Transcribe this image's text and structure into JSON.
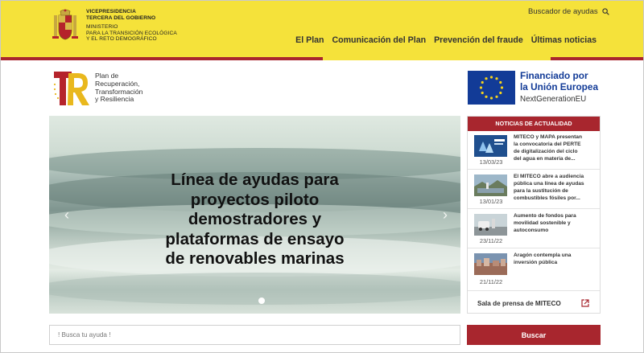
{
  "header": {
    "gov_lines": [
      "VICEPRESIDENCIA",
      "TERCERA DEL GOBIERNO"
    ],
    "ministry_lines": [
      "MINISTERIO",
      "PARA LA TRANSICIÓN ECOLÓGICA",
      "Y EL RETO DEMOGRÁFICO"
    ],
    "search_link": "Buscador de ayudas",
    "nav": [
      "El Plan",
      "Comunicación del Plan",
      "Prevención del fraude",
      "Últimas noticias"
    ]
  },
  "plan_logo": {
    "lines": [
      "Plan de",
      "Recuperación,",
      "Transformación",
      "y Resiliencia"
    ]
  },
  "eu_logo": {
    "line1": "Financiado por",
    "line2": "la Unión Europea",
    "line3": "NextGenerationEU"
  },
  "carousel": {
    "caption_lines": [
      "Línea de ayudas para",
      "proyectos piloto",
      "demostradores y",
      "plataformas de ensayo",
      "de renovables marinas"
    ],
    "prev": "‹",
    "next": "›"
  },
  "news": {
    "title": "NOTICIAS DE ACTUALIDAD",
    "items": [
      {
        "lines": [
          "MITECO y MAPA presentan",
          "la convocatoria del PERTE",
          "de digitalización del ciclo",
          "del agua en materia de..."
        ],
        "date": "13/03/23"
      },
      {
        "lines": [
          "El MITECO abre a audiencia",
          "pública una línea de ayudas",
          "para la sustitución de",
          "combustibles fósiles por..."
        ],
        "date": "13/01/23"
      },
      {
        "lines": [
          "Aumento de fondos para",
          "movilidad sostenible y",
          "autoconsumo"
        ],
        "date": "23/11/22"
      },
      {
        "lines": [
          "Aragón contempla una",
          "inversión pública"
        ],
        "date": "21/11/22"
      }
    ],
    "press_label": "Sala de prensa de MITECO"
  },
  "search": {
    "placeholder": "! Busca tu ayuda !",
    "button": "Buscar"
  },
  "colors": {
    "header_yellow": "#f5e23a",
    "accent_red": "#a8262e",
    "eu_blue": "#123b97"
  }
}
